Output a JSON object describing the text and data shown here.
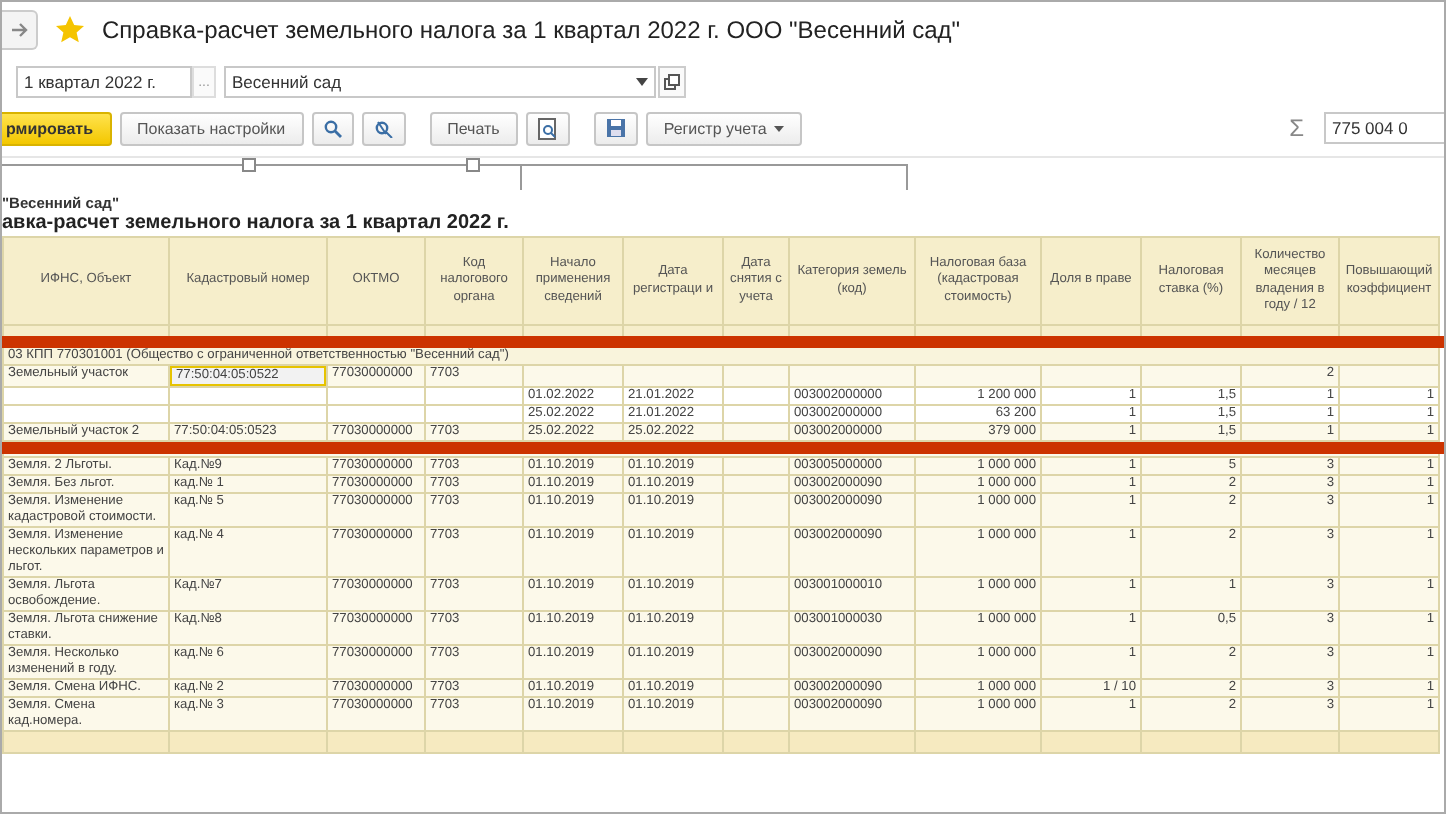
{
  "window": {
    "title": "Справка-расчет земельного налога за 1 квартал 2022 г. ООО \"Весенний сад\""
  },
  "params": {
    "period": "1 квартал 2022 г.",
    "period_button": "...",
    "organization": "Весенний сад"
  },
  "toolbar": {
    "generate": "рмировать",
    "settings": "Показать настройки",
    "print": "Печать",
    "register": "Регистр учета",
    "sum_sign": "Σ",
    "sum": "775 004 0"
  },
  "report": {
    "company": "\"Весенний сад\"",
    "title": "авка-расчет земельного налога за 1 квартал 2022 г."
  },
  "table": {
    "columns": [
      "ИФНС, Объект",
      "Кадастровый номер",
      "ОКТМО",
      "Код налогового органа",
      "Начало применения сведений",
      "Дата регистраци и",
      "Дата снятия с учета",
      "Категория земель (код)",
      "Налоговая база (кадастровая стоимость)",
      "Доля в праве",
      "Налоговая ставка (%)",
      "Количество месяцев владения в году / 12",
      "Повышающий коэффициент"
    ],
    "rows": [
      {
        "kind": "group",
        "text": "03 КПП 770301001 (Общество с ограниченной ответственностью \"Весенний сад\")"
      },
      {
        "kind": "item",
        "cadastral_selected": true,
        "cells": [
          "Земельный участок",
          "77:50:04:05:0522",
          "77030000000",
          "7703",
          "",
          "",
          "",
          "",
          "",
          "",
          "",
          "2",
          ""
        ]
      },
      {
        "kind": "detail",
        "cadastral_selected": false,
        "cells": [
          "",
          "",
          "",
          "",
          "01.02.2022",
          "21.01.2022",
          "",
          "003002000000",
          "1 200 000",
          "1",
          "1,5",
          "1",
          "1"
        ]
      },
      {
        "kind": "detail",
        "cadastral_selected": false,
        "cells": [
          "",
          "",
          "",
          "",
          "25.02.2022",
          "21.01.2022",
          "",
          "003002000000",
          "63 200",
          "1",
          "1,5",
          "1",
          "1"
        ]
      },
      {
        "kind": "item",
        "cadastral_selected": false,
        "cells": [
          "Земельный участок 2",
          "77:50:04:05:0523",
          "77030000000",
          "7703",
          "25.02.2022",
          "25.02.2022",
          "",
          "003002000000",
          "379 000",
          "1",
          "1,5",
          "1",
          "1"
        ]
      },
      {
        "kind": "hidden"
      },
      {
        "kind": "item",
        "cadastral_selected": false,
        "cells": [
          "Земля. 2 Льготы.",
          "Кад.№9",
          "77030000000",
          "7703",
          "01.10.2019",
          "01.10.2019",
          "",
          "003005000000",
          "1 000 000",
          "1",
          "5",
          "3",
          "1"
        ]
      },
      {
        "kind": "item",
        "cadastral_selected": false,
        "cells": [
          "Земля. Без льгот.",
          "кад.№ 1",
          "77030000000",
          "7703",
          "01.10.2019",
          "01.10.2019",
          "",
          "003002000090",
          "1 000 000",
          "1",
          "2",
          "3",
          "1"
        ]
      },
      {
        "kind": "item",
        "cadastral_selected": false,
        "cells": [
          "Земля. Изменение кадастровой стоимости.",
          "кад.№ 5",
          "77030000000",
          "7703",
          "01.10.2019",
          "01.10.2019",
          "",
          "003002000090",
          "1 000 000",
          "1",
          "2",
          "3",
          "1"
        ]
      },
      {
        "kind": "item",
        "cadastral_selected": false,
        "cells": [
          "Земля. Изменение нескольких параметров и льгот.",
          "кад.№ 4",
          "77030000000",
          "7703",
          "01.10.2019",
          "01.10.2019",
          "",
          "003002000090",
          "1 000 000",
          "1",
          "2",
          "3",
          "1"
        ]
      },
      {
        "kind": "item",
        "cadastral_selected": false,
        "cells": [
          "Земля. Льгота освобождение.",
          "Кад.№7",
          "77030000000",
          "7703",
          "01.10.2019",
          "01.10.2019",
          "",
          "003001000010",
          "1 000 000",
          "1",
          "1",
          "3",
          "1"
        ]
      },
      {
        "kind": "item",
        "cadastral_selected": false,
        "cells": [
          "Земля. Льгота снижение ставки.",
          "Кад.№8",
          "77030000000",
          "7703",
          "01.10.2019",
          "01.10.2019",
          "",
          "003001000030",
          "1 000 000",
          "1",
          "0,5",
          "3",
          "1"
        ]
      },
      {
        "kind": "item",
        "cadastral_selected": false,
        "cells": [
          "Земля. Несколько изменений в году.",
          "кад.№ 6",
          "77030000000",
          "7703",
          "01.10.2019",
          "01.10.2019",
          "",
          "003002000090",
          "1 000 000",
          "1",
          "2",
          "3",
          "1"
        ]
      },
      {
        "kind": "item",
        "cadastral_selected": false,
        "cells": [
          "Земля. Смена ИФНС.",
          "кад.№ 2",
          "77030000000",
          "7703",
          "01.10.2019",
          "01.10.2019",
          "",
          "003002000090",
          "1 000 000",
          "1 / 10",
          "2",
          "3",
          "1"
        ]
      },
      {
        "kind": "item",
        "cadastral_selected": false,
        "cells": [
          "Земля. Смена кад.номера.",
          "кад.№ 3",
          "77030000000",
          "7703",
          "01.10.2019",
          "01.10.2019",
          "",
          "003002000090",
          "1 000 000",
          "1",
          "2",
          "3",
          "1"
        ]
      },
      {
        "kind": "total"
      }
    ]
  }
}
